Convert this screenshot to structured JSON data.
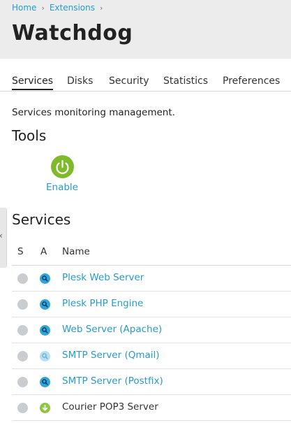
{
  "breadcrumb": {
    "home": "Home",
    "extensions": "Extensions"
  },
  "page_title": "Watchdog",
  "tabs": [
    {
      "label": "Services",
      "active": true
    },
    {
      "label": "Disks",
      "active": false
    },
    {
      "label": "Security",
      "active": false
    },
    {
      "label": "Statistics",
      "active": false
    },
    {
      "label": "Preferences",
      "active": false
    }
  ],
  "description": "Services monitoring management.",
  "tools": {
    "title": "Tools",
    "enable_label": "Enable",
    "enable_icon": "power-icon"
  },
  "services": {
    "title": "Services",
    "columns": {
      "s": "S",
      "a": "A",
      "name": "Name"
    },
    "rows": [
      {
        "name": "Plesk Web Server",
        "status": "inactive",
        "action_icon": "search-icon",
        "link": true
      },
      {
        "name": "Plesk PHP Engine",
        "status": "inactive",
        "action_icon": "search-icon",
        "link": true
      },
      {
        "name": "Web Server (Apache)",
        "status": "inactive",
        "action_icon": "search-icon",
        "link": true
      },
      {
        "name": "SMTP Server (Qmail)",
        "status": "inactive",
        "action_icon": "search-icon-disabled",
        "link": true
      },
      {
        "name": "SMTP Server (Postfix)",
        "status": "inactive",
        "action_icon": "search-icon",
        "link": true
      },
      {
        "name": "Courier POP3 Server",
        "status": "inactive",
        "action_icon": "download-icon",
        "link": false
      }
    ]
  },
  "colors": {
    "accent": "#259ccc",
    "enable_green": "#7fba2a",
    "header_bg": "#ececec"
  }
}
